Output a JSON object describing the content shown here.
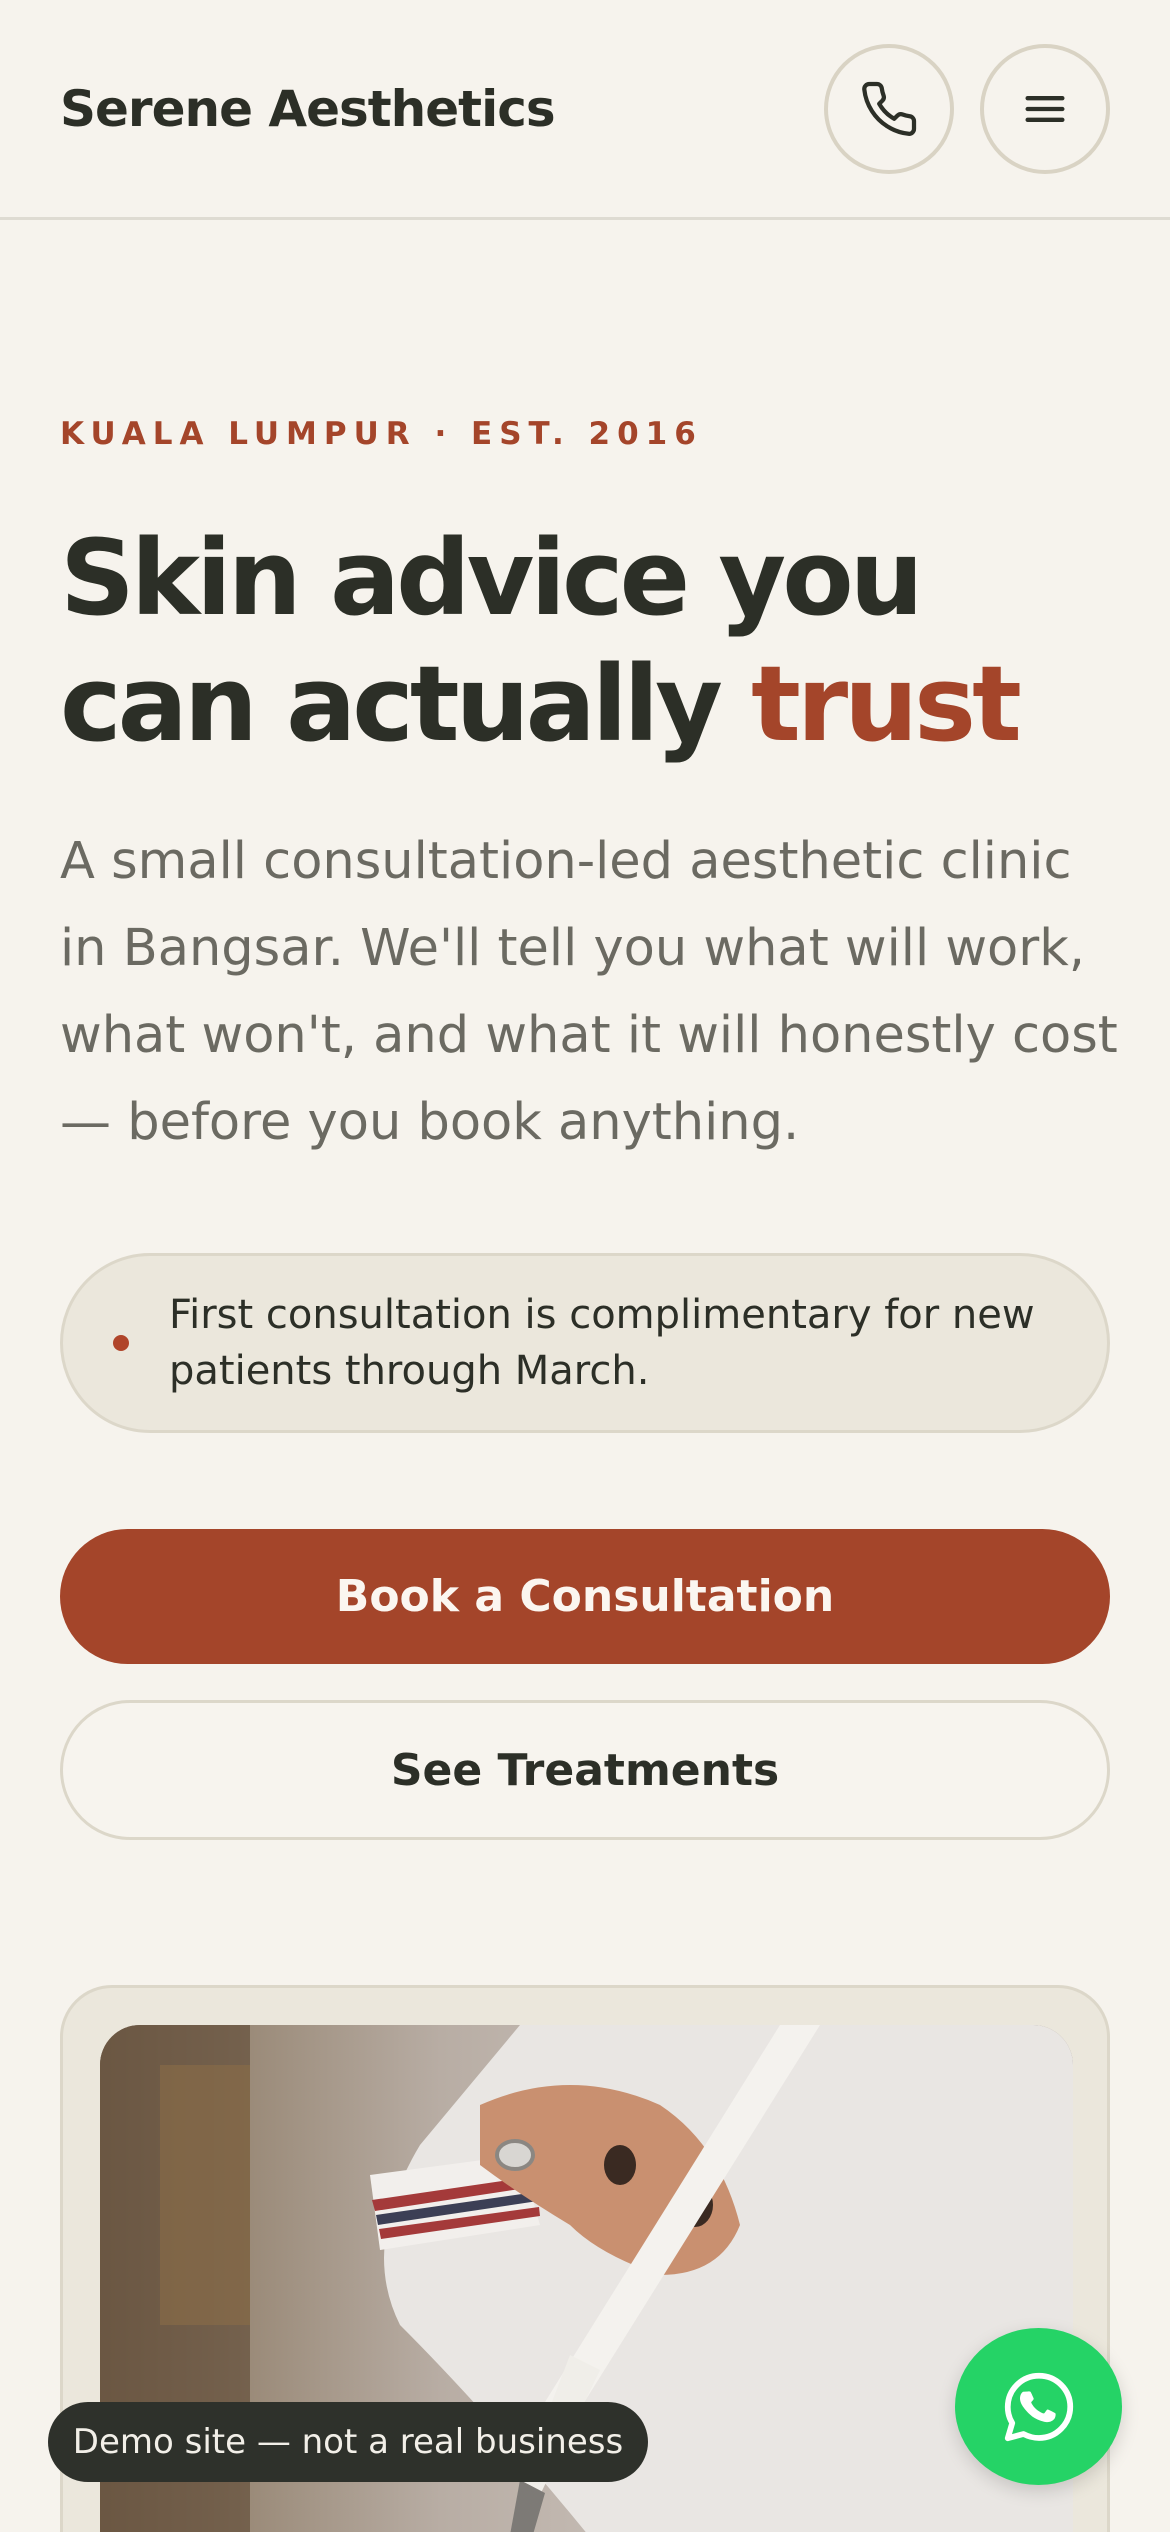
{
  "header": {
    "brand": "Serene Aesthetics",
    "call_icon": "phone-icon",
    "menu_icon": "hamburger-menu-icon"
  },
  "hero": {
    "eyebrow": "KUALA LUMPUR · EST. 2016",
    "headline_part1": "Skin advice you can actually ",
    "headline_accent": "trust",
    "intro": "A small consultation-led aesthetic clinic in Bangsar. We'll tell you what will work, what won't, and what it will honestly cost — before you book anything.",
    "notice": "First consultation is complimentary for new patients through March.",
    "primary_cta": "Book a Consultation",
    "secondary_cta": "See Treatments"
  },
  "floating": {
    "demo_notice": "Demo site — not a real business",
    "whatsapp_icon": "whatsapp-icon"
  },
  "colors": {
    "background": "#f6f3ed",
    "accent": "#a4452a",
    "text": "#2c2f27",
    "muted_text": "#6b6a62",
    "whatsapp": "#25d366"
  }
}
